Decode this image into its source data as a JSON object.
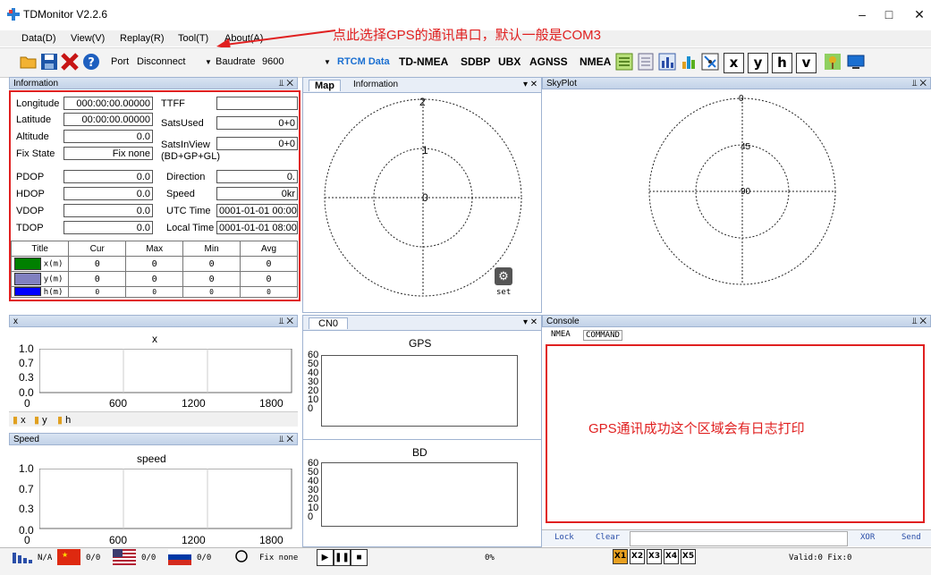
{
  "window": {
    "title": "TDMonitor V2.2.6"
  },
  "menu": [
    "Data(D)",
    "View(V)",
    "Replay(R)",
    "Tool(T)",
    "About(A)"
  ],
  "annotation_top": "点此选择GPS的通讯串口，默认一般是COM3",
  "toolbar": {
    "port_label": "Port",
    "port_value": "Disconnect",
    "baud_label": "Baudrate",
    "baud_value": "9600",
    "buttons": [
      "RTCM Data",
      "TD-NMEA",
      "SDBP",
      "UBX",
      "AGNSS",
      "NMEA"
    ],
    "letter_buttons": [
      "x",
      "y",
      "h",
      "v"
    ]
  },
  "information": {
    "title": "Information",
    "longitude_label": "Longitude",
    "longitude": "000:00:00.00000",
    "latitude_label": "Latitude",
    "latitude": "00:00:00.00000",
    "altitude_label": "Altitude",
    "altitude": "0.0",
    "fixstate_label": "Fix State",
    "fixstate": "Fix none",
    "ttff_label": "TTFF",
    "ttff": "",
    "satsused_label": "SatsUsed",
    "satsused": "0+0",
    "satsinview_label": "SatsInView",
    "satsinview_sub": "(BD+GP+GL)",
    "satsinview": "0+0",
    "pdop_label": "PDOP",
    "pdop": "0.0",
    "hdop_label": "HDOP",
    "hdop": "0.0",
    "vdop_label": "VDOP",
    "vdop": "0.0",
    "tdop_label": "TDOP",
    "tdop": "0.0",
    "direction_label": "Direction",
    "direction": "0.",
    "speed_label": "Speed",
    "speed": "0kr",
    "utc_label": "UTC Time",
    "utc": "0001-01-01 00:00",
    "local_label": "Local Time",
    "local": "0001-01-01 08:00",
    "table_headers": [
      "Title",
      "Cur",
      "Max",
      "Min",
      "Avg"
    ],
    "rows": [
      {
        "name": "x(m)",
        "color": "#008000",
        "cur": "0",
        "max": "0",
        "min": "0",
        "avg": "0"
      },
      {
        "name": "y(m)",
        "color": "#8080c0",
        "cur": "0",
        "max": "0",
        "min": "0",
        "avg": "0"
      },
      {
        "name": "h(m)",
        "color": "#0000ff",
        "cur": "0",
        "max": "0",
        "min": "0",
        "avg": "0"
      }
    ]
  },
  "map": {
    "tab1": "Map",
    "tab2": "Information",
    "ring_labels": [
      "2",
      "1",
      "0"
    ],
    "set_label": "set"
  },
  "skyplot": {
    "title": "SkyPlot",
    "labels": [
      "0",
      "45",
      "90"
    ]
  },
  "x_panel": {
    "title": "x",
    "chart_title": "x",
    "yticks": [
      "1.0",
      "0.7",
      "0.3",
      "0.0"
    ],
    "xticks": [
      "0",
      "600",
      "1200",
      "1800"
    ],
    "tabs": [
      "x",
      "y",
      "h"
    ]
  },
  "speed_panel": {
    "title": "Speed",
    "chart_title": "speed",
    "yticks": [
      "1.0",
      "0.7",
      "0.3",
      "0.0"
    ],
    "xticks": [
      "0",
      "600",
      "1200",
      "1800"
    ]
  },
  "cn0": {
    "tab": "CN0",
    "gps_title": "GPS",
    "bd_title": "BD",
    "yticks": [
      "60",
      "50",
      "40",
      "30",
      "20",
      "10",
      "0"
    ]
  },
  "console": {
    "title": "Console",
    "tabs": [
      "NMEA",
      "COMMAND"
    ],
    "annotation": "GPS通讯成功这个区域会有日志打印",
    "lock": "Lock",
    "clear": "Clear",
    "xor": "XOR",
    "send": "Send"
  },
  "status": {
    "na": "N/A",
    "cn_count": "0/0",
    "us_count": "0/0",
    "ru_count": "0/0",
    "fix": "Fix none",
    "progress": "0%",
    "speeds": [
      "X1",
      "X2",
      "X3",
      "X4",
      "X5"
    ],
    "valid": "Valid:0 Fix:0"
  }
}
